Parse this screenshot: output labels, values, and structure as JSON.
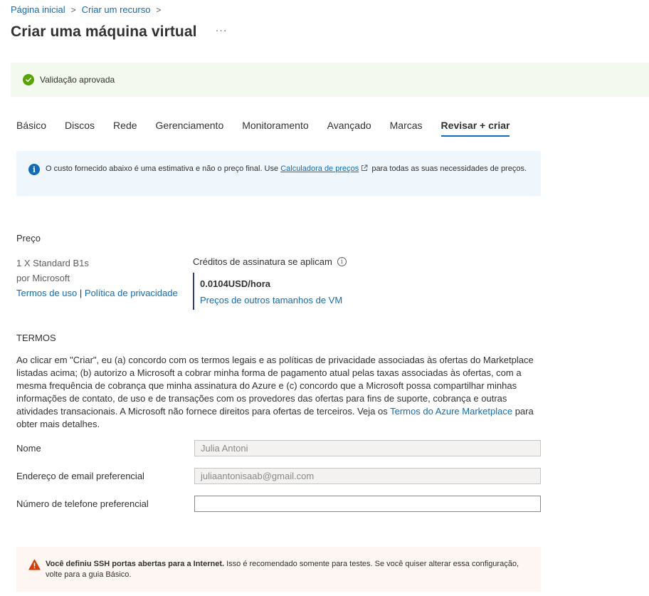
{
  "breadcrumb": {
    "items": [
      "Página inicial",
      "Criar um recurso"
    ],
    "sep": ">"
  },
  "header": {
    "title": "Criar uma máquina virtual",
    "more": "···"
  },
  "validation": {
    "text": "Validação aprovada",
    "status_color": "#57a300"
  },
  "tabs": [
    {
      "label": "Básico"
    },
    {
      "label": "Discos"
    },
    {
      "label": "Rede"
    },
    {
      "label": "Gerenciamento"
    },
    {
      "label": "Monitoramento"
    },
    {
      "label": "Avançado"
    },
    {
      "label": "Marcas"
    },
    {
      "label": "Revisar + criar",
      "active": true
    }
  ],
  "info": {
    "text_before": "O custo fornecido abaixo é uma estimativa e não o preço final. Use ",
    "link": "Calculadora de preços",
    "text_after": " para todas as suas necessidades de preços."
  },
  "price": {
    "heading": "Preço",
    "product": "1 X Standard B1s",
    "publisher": "por Microsoft",
    "terms_link": "Termos de uso",
    "separator": "|",
    "privacy_link": "Política de privacidade",
    "credits_label": "Créditos de assinatura se aplicam",
    "value": "0.0104USD/hora",
    "other_sizes_link": "Preços de outros tamanhos de VM"
  },
  "terms": {
    "heading": "TERMOS",
    "text": "Ao clicar em \"Criar\", eu (a) concordo com os termos legais e as políticas de privacidade associadas às ofertas do Marketplace listadas acima; (b) autorizo a Microsoft a cobrar minha forma de pagamento atual pelas taxas associadas às ofertas, com a mesma frequência de cobrança que minha assinatura do Azure e (c) concordo que a Microsoft possa compartilhar minhas informações de contato, de uso e de transações com os provedores das ofertas para fins de suporte, cobrança e outras atividades transacionais. A Microsoft não fornece direitos para ofertas de terceiros. Veja os ",
    "link": "Termos do Azure Marketplace",
    "text_end": " para obter mais detalhes."
  },
  "form": {
    "name_label": "Nome",
    "name_value": "Julia Antoni",
    "email_label": "Endereço de email preferencial",
    "email_value": "juliaantonisaab@gmail.com",
    "phone_label": "Número de telefone preferencial",
    "phone_value": ""
  },
  "warning": {
    "bold": "Você definiu SSH portas abertas para a Internet.",
    "text": "  Isso é recomendado somente para testes.  Se você quiser alterar essa configuração, volte para a guia Básico.",
    "color": "#d83b01"
  }
}
